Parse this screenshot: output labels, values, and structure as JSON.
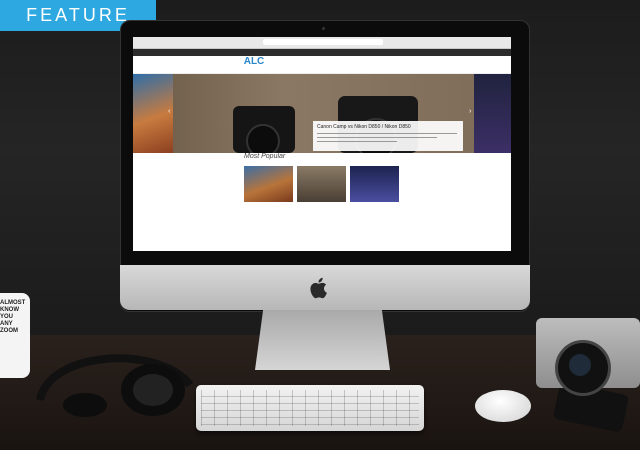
{
  "badge": {
    "label": "FEATURE",
    "color": "#2ea8e0"
  },
  "website": {
    "logo": {
      "main": "ALC",
      "sub": ""
    },
    "nav_items": [
      "",
      "",
      "",
      "",
      "",
      ""
    ],
    "hero": {
      "title": "Canon Camp vs Nikon D850 / Nikon D850"
    },
    "section": {
      "title": "Most Popular",
      "links": ""
    },
    "cards": [
      {
        "image": "landscape",
        "title": "",
        "desc": ""
      },
      {
        "image": "cameras",
        "title": "",
        "desc": ""
      },
      {
        "image": "night-sky",
        "title": "",
        "desc": ""
      }
    ]
  },
  "scene": {
    "mug_text": [
      "ALMOST",
      "KNOW YOU",
      "ANY ZOOM"
    ],
    "computer_logo": "apple-logo-icon"
  }
}
